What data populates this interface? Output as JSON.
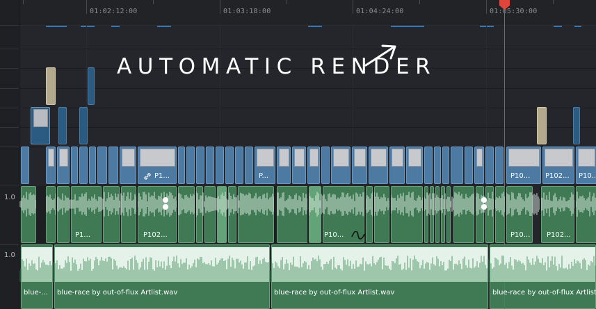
{
  "ruler": {
    "timecodes": [
      "01:02:12:00",
      "01:03:18:00",
      "01:04:24:00",
      "01:05:30:00"
    ]
  },
  "overlay": {
    "text": "AUTOMATIC RENDER"
  },
  "tracks": {
    "audio_level_a1": "1.0",
    "audio_level_a2": "1.0"
  },
  "video_clip_labels": [
    "P1...",
    "P...",
    "P10...",
    "P102...",
    "P10..."
  ],
  "audio_clip_labels": [
    "P1...",
    "P102...",
    "P10...",
    "P10...",
    "P102..."
  ],
  "music_clip_labels": [
    "blue-...",
    "blue-race by out-of-flux Artlist.wav",
    "blue-race by out-of-flux Artlist.wav",
    "blue-race by out-of-flux Artlist.wav"
  ],
  "colors": {
    "video_clip": "#4d7aa3",
    "audio_clip": "#3f7a55",
    "music_band": "#e5f2e9",
    "playhead": "#d3433a",
    "marker": "#2f79b8"
  },
  "icons": [
    "link-icon",
    "playhead-icon",
    "arrow-icon",
    "curve-keyframe-icon"
  ]
}
